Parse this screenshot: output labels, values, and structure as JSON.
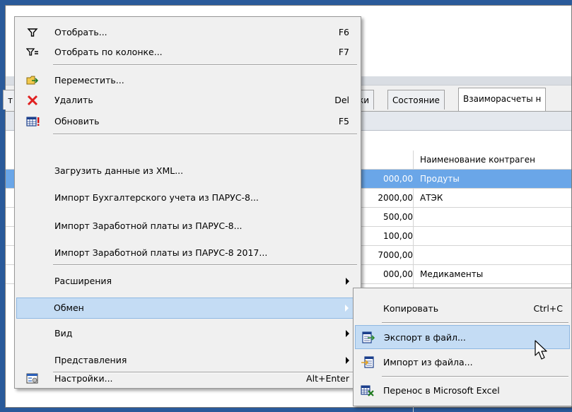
{
  "window": {
    "tabs": [
      "т",
      "ки",
      "Состояние",
      "Взаиморасчеты н"
    ]
  },
  "grid": {
    "column_header": "Наименование контраген",
    "rows": [
      {
        "amount": "000,00",
        "name": "Продуты",
        "selected": true
      },
      {
        "amount": "2000,00",
        "name": "АТЭК",
        "selected": false
      },
      {
        "amount": "500,00",
        "name": "",
        "selected": false
      },
      {
        "amount": "100,00",
        "name": "",
        "selected": false
      },
      {
        "amount": "7000,00",
        "name": "",
        "selected": false
      },
      {
        "amount": "000,00",
        "name": "Медикаменты",
        "selected": false
      }
    ]
  },
  "menu": {
    "items": [
      {
        "label": "Отобрать...",
        "shortcut": "F6",
        "icon": "filter-icon"
      },
      {
        "label": "Отобрать по колонке...",
        "shortcut": "F7",
        "icon": "filter-column-icon"
      },
      {
        "label": "Переместить...",
        "shortcut": "",
        "icon": "move-folder-icon"
      },
      {
        "label": "Удалить",
        "shortcut": "Del",
        "icon": "delete-x-icon"
      },
      {
        "label": "Обновить",
        "shortcut": "F5",
        "icon": "refresh-table-icon"
      },
      {
        "label": "Загрузить данные из XML...",
        "shortcut": ""
      },
      {
        "label": "Импорт Бухгалтерского учета из ПАРУС-8...",
        "shortcut": ""
      },
      {
        "label": "Импорт Заработной платы из ПАРУС-8...",
        "shortcut": ""
      },
      {
        "label": "Импорт Заработной платы из ПАРУС-8 2017...",
        "shortcut": ""
      },
      {
        "label": "Расширения",
        "shortcut": ""
      },
      {
        "label": "Обмен",
        "shortcut": ""
      },
      {
        "label": "Вид",
        "shortcut": ""
      },
      {
        "label": "Представления",
        "shortcut": ""
      },
      {
        "label": "Настройки...",
        "shortcut": "Alt+Enter",
        "icon": "settings-icon"
      }
    ]
  },
  "submenu": {
    "items": [
      {
        "label": "Копировать",
        "shortcut": "Ctrl+C"
      },
      {
        "label": "Экспорт в файл...",
        "shortcut": "",
        "icon": "export-file-icon"
      },
      {
        "label": "Импорт из файла...",
        "shortcut": "",
        "icon": "import-file-icon"
      },
      {
        "label": "Перенос в Microsoft Excel",
        "shortcut": "",
        "icon": "excel-transfer-icon"
      }
    ]
  },
  "colors": {
    "highlight": "#c4dcf4",
    "highlight_border": "#8fb8e2",
    "selected_row": "#6aa6e8",
    "desktop": "#2a5a9a"
  }
}
